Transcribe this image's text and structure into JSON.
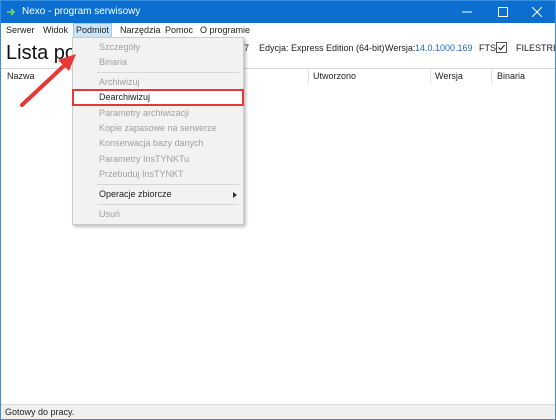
{
  "window": {
    "title": "Nexo - program serwisowy",
    "title_bar_color": "#0a6fd0"
  },
  "menu": {
    "items": [
      "Serwer",
      "Widok",
      "Podmiot",
      "Narzędzia",
      "Pomoc",
      "O programie"
    ],
    "active": "Podmiot"
  },
  "header": {
    "title": "Lista pod",
    "num_fragment": "7",
    "edition": "Edycja: Express Edition (64-bit)",
    "version_label": "Wersja:",
    "version_value": "14.0.1000.169",
    "fts_label": "FTS:",
    "fts_checked": true,
    "filestream_label": "FILESTREA"
  },
  "table": {
    "columns": [
      "Nazwa",
      "Utworzono",
      "Wersja",
      "Binaria"
    ]
  },
  "dropdown": {
    "items": [
      {
        "label": "Szczegóły",
        "enabled": false
      },
      {
        "label": "Binaria",
        "enabled": false
      },
      {
        "label": "Archiwizuj",
        "enabled": false
      },
      {
        "label": "Dearchiwizuj",
        "enabled": true,
        "highlighted": true
      },
      {
        "label": "Parametry archiwizacji",
        "enabled": false
      },
      {
        "label": "Kopie zapasowe na serwerze",
        "enabled": false
      },
      {
        "label": "Konserwacja bazy danych",
        "enabled": false
      },
      {
        "label": "Parametry InsTYNKTu",
        "enabled": false
      },
      {
        "label": "Przebuduj InsTYNKT",
        "enabled": false
      },
      {
        "label": "Operacje zbiorcze",
        "enabled": true,
        "submenu": true
      },
      {
        "label": "Usuń",
        "enabled": false
      }
    ],
    "highlight_color": "#e53935"
  },
  "status": {
    "text": "Gotowy do pracy."
  },
  "icons": {
    "app": "app-arrow-icon",
    "minimize": "minimize-icon",
    "maximize": "maximize-icon",
    "close": "close-icon",
    "submenu": "chevron-right-icon",
    "annotation": "red-arrow-icon"
  }
}
